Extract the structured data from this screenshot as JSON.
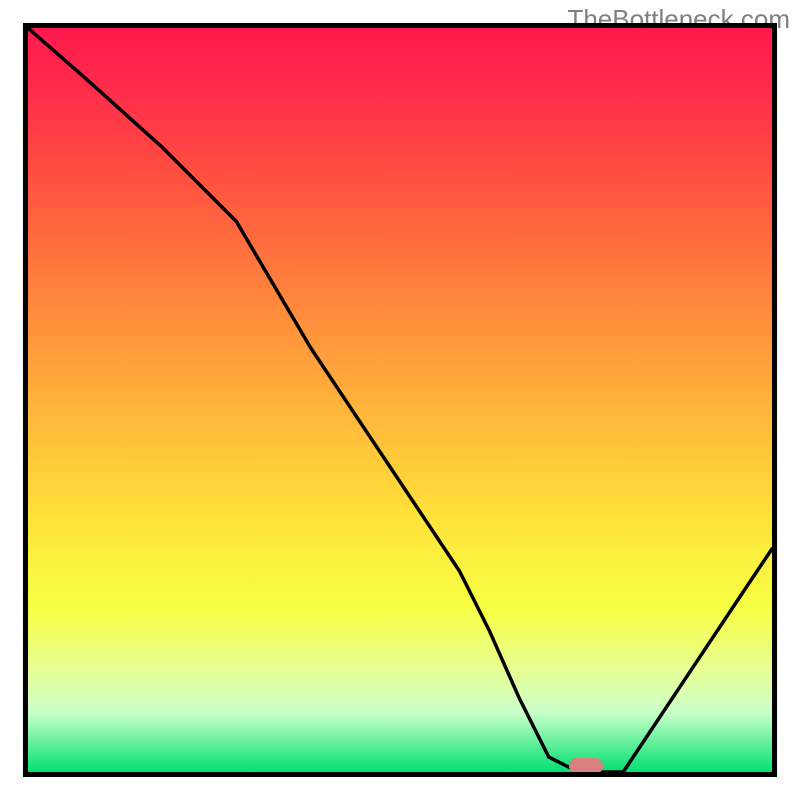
{
  "watermark": "TheBottleneck.com",
  "chart_data": {
    "type": "line",
    "title": "",
    "xlabel": "",
    "ylabel": "",
    "xlim": [
      0,
      100
    ],
    "ylim": [
      0,
      100
    ],
    "grid": false,
    "background_gradient": {
      "top_color": "#ff1a4d",
      "bottom_color": "#00e070",
      "description": "vertical red-to-green gradient signifying bottleneck severity"
    },
    "series": [
      {
        "name": "bottleneck-curve",
        "color": "#000000",
        "x": [
          0,
          8,
          18,
          28,
          38,
          48,
          58,
          62,
          66,
          70,
          74,
          80,
          88,
          96,
          100
        ],
        "values": [
          100,
          93,
          84,
          74,
          57,
          42,
          27,
          19,
          10,
          2,
          0,
          0,
          12,
          24,
          30
        ]
      }
    ],
    "marker": {
      "name": "optimal-point",
      "x": 75,
      "y": 0,
      "color": "#d98080"
    }
  }
}
